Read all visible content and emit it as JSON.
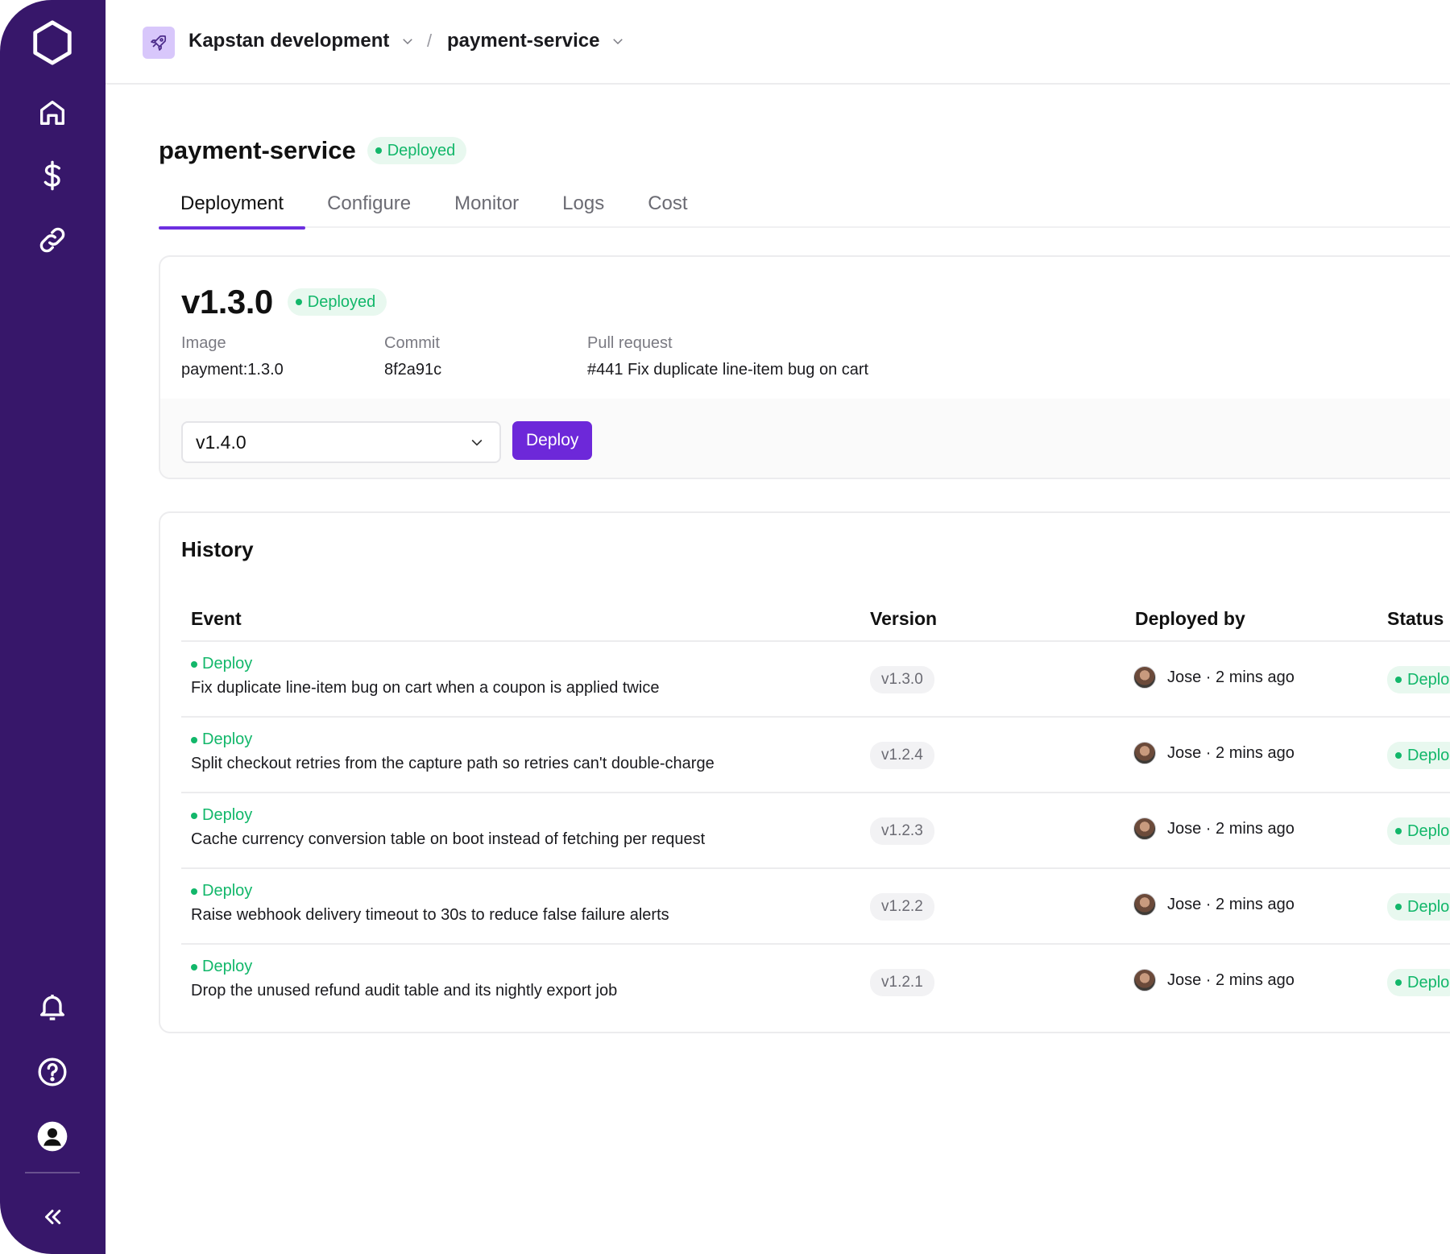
{
  "colors": {
    "sidebar_bg": "#37176a",
    "accent": "#6d28d9",
    "success": "#12b76a",
    "success_bg": "#e8f8ef"
  },
  "sidebar": {
    "top_items": [
      {
        "icon": "home-icon"
      },
      {
        "icon": "dollar-icon"
      },
      {
        "icon": "link-icon"
      }
    ],
    "bottom_items": [
      {
        "icon": "bell-icon"
      },
      {
        "icon": "help-icon"
      },
      {
        "icon": "user-icon"
      }
    ],
    "collapse_icon": "double-chevron-left-icon"
  },
  "breadcrumb": {
    "project_icon": "rocket-icon",
    "project": "Kapstan development",
    "separator": "/",
    "service": "payment-service"
  },
  "page": {
    "title": "payment-service",
    "status": "Deployed"
  },
  "tabs": [
    {
      "label": "Deployment",
      "active": true
    },
    {
      "label": "Configure",
      "active": false
    },
    {
      "label": "Monitor",
      "active": false
    },
    {
      "label": "Logs",
      "active": false
    },
    {
      "label": "Cost",
      "active": false
    }
  ],
  "current": {
    "version": "v1.3.0",
    "status": "Deployed",
    "image_label": "Image",
    "image": "payment:1.3.0",
    "commit_label": "Commit",
    "commit": "8f2a91c",
    "pr_label": "Pull request",
    "pr": "#441 Fix duplicate line-item bug on cart",
    "selected_version": "v1.4.0",
    "deploy_label": "Deploy"
  },
  "history": {
    "title": "History",
    "columns": [
      "Event",
      "Version",
      "Deployed by",
      "Status"
    ],
    "rows": [
      {
        "type": "Deploy",
        "description": "Fix duplicate line-item bug on cart when a coupon is applied twice",
        "version": "v1.3.0",
        "deployed_by": "Jose · 2 mins ago",
        "status": "Deplo"
      },
      {
        "type": "Deploy",
        "description": "Split checkout retries from the capture path so retries can't double-charge",
        "version": "v1.2.4",
        "deployed_by": "Jose · 2 mins ago",
        "status": "Deplo"
      },
      {
        "type": "Deploy",
        "description": "Cache currency conversion table on boot instead of fetching per request",
        "version": "v1.2.3",
        "deployed_by": "Jose · 2 mins ago",
        "status": "Deplo"
      },
      {
        "type": "Deploy",
        "description": "Raise webhook delivery timeout to 30s to reduce false failure alerts",
        "version": "v1.2.2",
        "deployed_by": "Jose · 2 mins ago",
        "status": "Deplo"
      },
      {
        "type": "Deploy",
        "description": "Drop the unused refund audit table and its nightly export job",
        "version": "v1.2.1",
        "deployed_by": "Jose · 2 mins ago",
        "status": "Deplo"
      }
    ]
  }
}
